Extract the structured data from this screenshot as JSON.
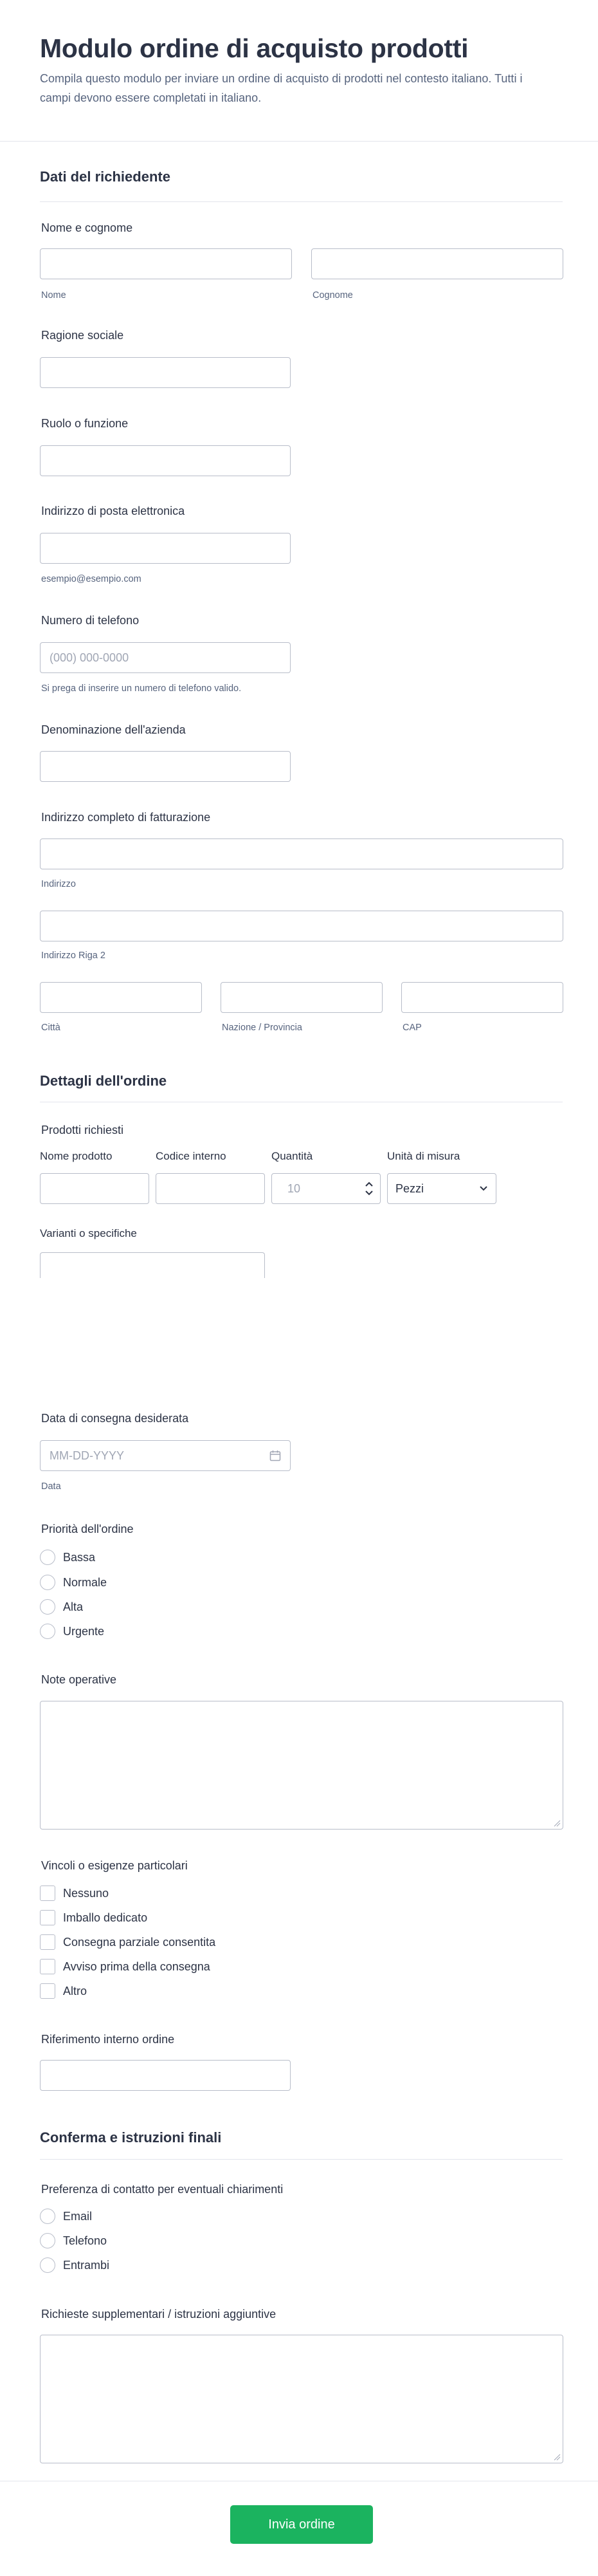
{
  "form": {
    "title": "Modulo ordine di acquisto prodotti",
    "description": "Compila questo modulo per inviare un ordine di acquisto di prodotti nel contesto italiano. Tutti i campi devono essere completati in italiano."
  },
  "requester": {
    "section_title": "Dati del richiedente",
    "full_name": {
      "label": "Nome e cognome",
      "first_sublabel": "Nome",
      "last_sublabel": "Cognome"
    },
    "company_name": {
      "label": "Ragione sociale"
    },
    "role": {
      "label": "Ruolo o funzione"
    },
    "email": {
      "label": "Indirizzo di posta elettronica",
      "hint": "esempio@esempio.com"
    },
    "phone": {
      "label": "Numero di telefono",
      "placeholder": "(000) 000-0000",
      "hint": "Si prega di inserire un numero di telefono valido."
    },
    "business_name": {
      "label": "Denominazione dell'azienda"
    },
    "billing_address": {
      "label": "Indirizzo completo di fatturazione",
      "line1_sublabel": "Indirizzo",
      "line2_sublabel": "Indirizzo Riga 2",
      "city_sublabel": "Città",
      "state_sublabel": "Nazione / Provincia",
      "zip_sublabel": "CAP"
    }
  },
  "order": {
    "section_title": "Dettagli dell'ordine",
    "products": {
      "label": "Prodotti richiesti",
      "columns": [
        "Nome prodotto",
        "Codice interno",
        "Quantità",
        "Unità di misura"
      ],
      "quantity_placeholder": "10",
      "unit_selected": "Pezzi",
      "variants_label": "Varianti o specifiche"
    },
    "delivery_date": {
      "label": "Data di consegna desiderata",
      "placeholder": "MM-DD-YYYY",
      "sublabel": "Data"
    },
    "priority": {
      "label": "Priorità dell'ordine",
      "options": [
        "Bassa",
        "Normale",
        "Alta",
        "Urgente"
      ]
    },
    "notes": {
      "label": "Note operative"
    },
    "constraints": {
      "label": "Vincoli o esigenze particolari",
      "options": [
        "Nessuno",
        "Imballo dedicato",
        "Consegna parziale consentita",
        "Avviso prima della consegna",
        "Altro"
      ]
    },
    "reference": {
      "label": "Riferimento interno ordine"
    }
  },
  "confirm": {
    "section_title": "Conferma e istruzioni finali",
    "contact_pref": {
      "label": "Preferenza di contatto per eventuali chiarimenti",
      "options": [
        "Email",
        "Telefono",
        "Entrambi"
      ]
    },
    "extra": {
      "label": "Richieste supplementari / istruzioni aggiuntive"
    }
  },
  "submit_label": "Invia ordine",
  "icons": {
    "calendar": "calendar-icon",
    "dropdown": "chevron-down-icon",
    "stepper": "stepper-arrows-icon",
    "resize": "resize-grip-icon"
  }
}
